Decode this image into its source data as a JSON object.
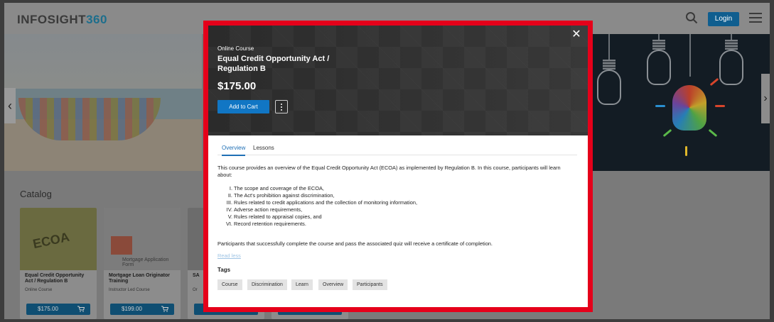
{
  "header": {
    "logo_main": "INFOSIGHT",
    "logo_num": "360",
    "login_label": "Login"
  },
  "colors": {
    "accent": "#1176c4",
    "highlight_outline": "#e5001a",
    "card_button": "#0f4e72"
  },
  "icons": {
    "search": "search-icon",
    "menu": "hamburger-icon",
    "close": "close-icon",
    "more": "more-vertical-icon",
    "cart": "cart-icon"
  },
  "catalog": {
    "title": "Catalog",
    "cards": [
      {
        "title": "Equal Credit Opportunity Act / Regulation B",
        "type": "Online Course",
        "price": "$175.00",
        "img_text": "ECOA"
      },
      {
        "title": "Mortgage Loan Originator Training",
        "type": "Instructor Led Course",
        "price": "$199.00",
        "img_text": "Mortgage Application Form"
      },
      {
        "title": "SA",
        "type": "Or",
        "price": "",
        "img_text": ""
      },
      {
        "title": "",
        "type": "",
        "price": "",
        "img_text": ""
      }
    ]
  },
  "modal": {
    "type": "Online Course",
    "title": "Equal Credit Opportunity Act / Regulation B",
    "price": "$175.00",
    "add_to_cart": "Add to Cart",
    "tabs": [
      {
        "label": "Overview",
        "active": true
      },
      {
        "label": "Lessons",
        "active": false
      }
    ],
    "description": "This course provides an overview of the Equal Credit Opportunity Act (ECOA) as implemented by Regulation B. In this course, participants will learn about:",
    "list": [
      {
        "num": "I.",
        "text": "The scope and coverage of the ECOA,"
      },
      {
        "num": "II.",
        "text": "The Act's prohibition against discrimination,"
      },
      {
        "num": "III.",
        "text": "Rules related to credit applications and the collection of monitoring information,"
      },
      {
        "num": "IV.",
        "text": "Adverse action requirements,"
      },
      {
        "num": "V.",
        "text": "Rules related to appraisal copies, and"
      },
      {
        "num": "VI.",
        "text": "Record retention requirements."
      }
    ],
    "completion_note": "Participants that successfully complete the course and pass the associated quiz will receive a certificate of completion.",
    "read_less": "Read less",
    "tags_heading": "Tags",
    "tags": [
      "Course",
      "Discrimination",
      "Learn",
      "Overview",
      "Participants"
    ]
  }
}
